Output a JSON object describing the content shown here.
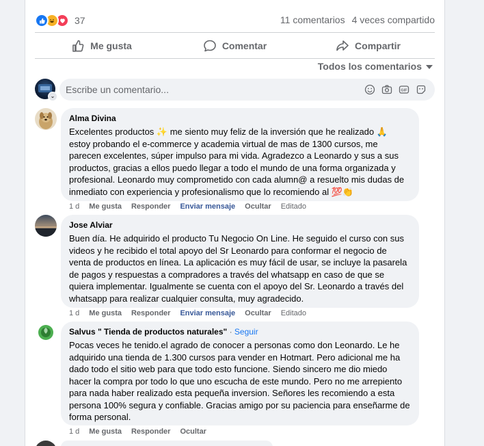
{
  "reactions": {
    "count": "37",
    "icons": [
      "like-icon",
      "haha-icon",
      "love-icon"
    ]
  },
  "stats": {
    "comments": "11 comentarios",
    "shares": "4 veces compartido"
  },
  "actions": {
    "like": "Me gusta",
    "comment": "Comentar",
    "share": "Compartir"
  },
  "sort": {
    "label": "Todos los comentarios"
  },
  "composer": {
    "placeholder": "Escribe un comentario..."
  },
  "comments": [
    {
      "author": "Alma Divina",
      "text": "Excelentes productos ✨ me siento muy feliz de la inversión que he realizado 🙏 estoy probando el e-commerce y academia virtual de mas de 1300 cursos, me parecen excelentes, súper impulso para mi vida. Agradezco a Leonardo y sus a sus productos, gracias a ellos puedo llegar a todo el mundo de una forma organizada y profesional. Leonardo muy comprometido con cada alumn@ a resuelto mis dudas de inmediato con experiencia y profesionalismo que lo recomiendo al 💯👏",
      "time": "1 d",
      "like": "Me gusta",
      "reply": "Responder",
      "message": "Enviar mensaje",
      "hide": "Ocultar",
      "edited": "Editado"
    },
    {
      "author": "Jose Alviar",
      "text": "Buen día. He adquirido el producto Tu Negocio On Line. He seguido el curso con sus videos y he recibido el total apoyo del Sr Leonardo para conformar el negocio de venta de productos en línea. La aplicación es muy fácil de usar, se incluye la pasarela de pagos y respuestas a compradores a través del whatsapp en caso de que se quiera implementar. Igualmente se cuenta con el apoyo del Sr. Leonardo a través del whatsapp para realizar cualquier consulta, muy agradecido.",
      "time": "1 d",
      "like": "Me gusta",
      "reply": "Responder",
      "message": "Enviar mensaje",
      "hide": "Ocultar",
      "edited": "Editado"
    },
    {
      "author": "Salvus \" Tienda de productos naturales\"",
      "follow_sep": "·",
      "follow": "Seguir",
      "text": "Pocas veces he tenido.el agrado de conocer a personas como don Leonardo. Le he adquirido una tienda de 1.300 cursos para vender en Hotmart. Pero adicional me ha dado todo el sitio web para que todo esto funcione. Siendo sincero me dio miedo hacer la compra por todo lo que uno escucha de este mundo. Pero no me arrepiento para nada haber realizado esta pequeña inversion. Señores les recomiendo a esta persona 100% segura y confiable. Gracias amigo por su paciencia para enseñarme de forma personal.",
      "time": "1 d",
      "like": "Me gusta",
      "reply": "Responder",
      "hide": "Ocultar"
    }
  ],
  "colors": {
    "accent": "#1877f2",
    "muted": "#65676b",
    "bubble": "#f0f2f5"
  }
}
